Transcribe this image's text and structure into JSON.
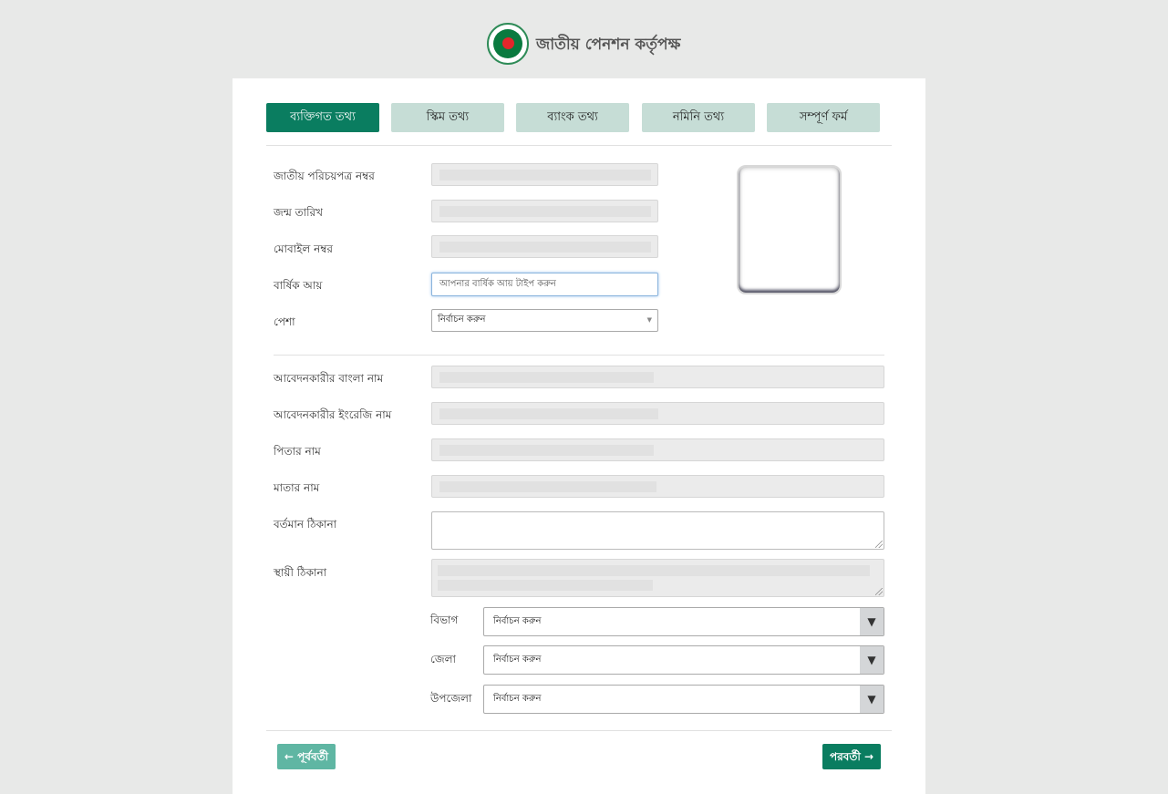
{
  "header": {
    "brand": "জাতীয় পেনশন কর্তৃপক্ষ"
  },
  "tabs": [
    {
      "label": "ব্যক্তিগত তথ্য",
      "active": true
    },
    {
      "label": "স্কিম তথ্য",
      "active": false
    },
    {
      "label": "ব্যাংক তথ্য",
      "active": false
    },
    {
      "label": "নমিনি তথ্য",
      "active": false
    },
    {
      "label": "সম্পূর্ণ ফর্ম",
      "active": false
    }
  ],
  "form": {
    "nid_label": "জাতীয় পরিচয়পত্র নম্বর",
    "dob_label": "জন্ম তারিখ",
    "mobile_label": "মোবাইল নম্বর",
    "income_label": "বার্ষিক আয়",
    "income_placeholder": "আপনার বার্ষিক আয় টাইপ করুন",
    "occupation_label": "পেশা",
    "occupation_value": "নির্বাচন করুন",
    "name_bn_label": "আবেদনকারীর বাংলা নাম",
    "name_en_label": "আবেদনকারীর ইংরেজি নাম",
    "father_label": "পিতার নাম",
    "mother_label": "মাতার নাম",
    "present_address_label": "বর্তমান ঠিকানা",
    "permanent_address_label": "স্থায়ী ঠিকানা",
    "division_label": "বিভাগ",
    "division_value": "নির্বাচন করুন",
    "district_label": "জেলা",
    "district_value": "নির্বাচন করুন",
    "upazila_label": "উপজেলা",
    "upazila_value": "নির্বাচন করুন"
  },
  "nav": {
    "prev": "← পূর্ববর্তী",
    "next": "পরবর্তী →"
  },
  "colors": {
    "primary": "#0a7d60",
    "tab_inactive": "#c6ddd6",
    "prev_button": "#5fb6a3",
    "page_bg": "#e8e9e8"
  }
}
